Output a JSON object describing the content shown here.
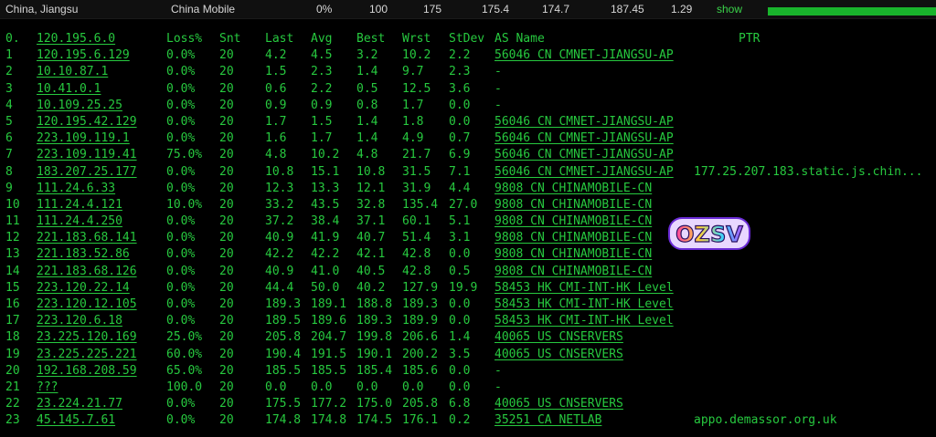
{
  "summary": {
    "location": "China, Jiangsu",
    "isp": "China Mobile",
    "loss": "0%",
    "sent": "100",
    "v1": "175",
    "v2": "175.4",
    "v3": "174.7",
    "v4": "187.45",
    "v5": "1.29",
    "show_label": "show"
  },
  "header": {
    "idx": "0.",
    "host": "120.195.6.0",
    "loss": "Loss%",
    "snt": "Snt",
    "last": "Last",
    "avg": "Avg",
    "best": "Best",
    "wrst": "Wrst",
    "stdev": "StDev",
    "as": "AS Name",
    "ptr": "PTR"
  },
  "hops": [
    {
      "idx": "1",
      "host": "120.195.6.129",
      "loss": "0.0%",
      "snt": "20",
      "last": "4.2",
      "avg": "4.5",
      "best": "3.2",
      "wrst": "10.2",
      "stdev": "2.2",
      "as": "56046 CN CMNET-JIANGSU-AP",
      "ptr": ""
    },
    {
      "idx": "2",
      "host": "10.10.87.1",
      "loss": "0.0%",
      "snt": "20",
      "last": "1.5",
      "avg": "2.3",
      "best": "1.4",
      "wrst": "9.7",
      "stdev": "2.3",
      "as": "-",
      "ptr": ""
    },
    {
      "idx": "3",
      "host": "10.41.0.1",
      "loss": "0.0%",
      "snt": "20",
      "last": "0.6",
      "avg": "2.2",
      "best": "0.5",
      "wrst": "12.5",
      "stdev": "3.6",
      "as": "-",
      "ptr": ""
    },
    {
      "idx": "4",
      "host": "10.109.25.25",
      "loss": "0.0%",
      "snt": "20",
      "last": "0.9",
      "avg": "0.9",
      "best": "0.8",
      "wrst": "1.7",
      "stdev": "0.0",
      "as": "-",
      "ptr": ""
    },
    {
      "idx": "5",
      "host": "120.195.42.129",
      "loss": "0.0%",
      "snt": "20",
      "last": "1.7",
      "avg": "1.5",
      "best": "1.4",
      "wrst": "1.8",
      "stdev": "0.0",
      "as": "56046 CN CMNET-JIANGSU-AP",
      "ptr": ""
    },
    {
      "idx": "6",
      "host": "223.109.119.1",
      "loss": "0.0%",
      "snt": "20",
      "last": "1.6",
      "avg": "1.7",
      "best": "1.4",
      "wrst": "4.9",
      "stdev": "0.7",
      "as": "56046 CN CMNET-JIANGSU-AP",
      "ptr": ""
    },
    {
      "idx": "7",
      "host": "223.109.119.41",
      "loss": "75.0%",
      "snt": "20",
      "last": "4.8",
      "avg": "10.2",
      "best": "4.8",
      "wrst": "21.7",
      "stdev": "6.9",
      "as": "56046 CN CMNET-JIANGSU-AP",
      "ptr": ""
    },
    {
      "idx": "8",
      "host": "183.207.25.177",
      "loss": "0.0%",
      "snt": "20",
      "last": "10.8",
      "avg": "15.1",
      "best": "10.8",
      "wrst": "31.5",
      "stdev": "7.1",
      "as": "56046 CN CMNET-JIANGSU-AP",
      "ptr": "177.25.207.183.static.js.chin..."
    },
    {
      "idx": "9",
      "host": "111.24.6.33",
      "loss": "0.0%",
      "snt": "20",
      "last": "12.3",
      "avg": "13.3",
      "best": "12.1",
      "wrst": "31.9",
      "stdev": "4.4",
      "as": "9808  CN CHINAMOBILE-CN",
      "ptr": ""
    },
    {
      "idx": "10",
      "host": "111.24.4.121",
      "loss": "10.0%",
      "snt": "20",
      "last": "33.2",
      "avg": "43.5",
      "best": "32.8",
      "wrst": "135.4",
      "stdev": "27.0",
      "as": "9808  CN CHINAMOBILE-CN",
      "ptr": ""
    },
    {
      "idx": "11",
      "host": "111.24.4.250",
      "loss": "0.0%",
      "snt": "20",
      "last": "37.2",
      "avg": "38.4",
      "best": "37.1",
      "wrst": "60.1",
      "stdev": "5.1",
      "as": "9808  CN CHINAMOBILE-CN",
      "ptr": ""
    },
    {
      "idx": "12",
      "host": "221.183.68.141",
      "loss": "0.0%",
      "snt": "20",
      "last": "40.9",
      "avg": "41.9",
      "best": "40.7",
      "wrst": "51.4",
      "stdev": "3.1",
      "as": "9808  CN CHINAMOBILE-CN",
      "ptr": ""
    },
    {
      "idx": "13",
      "host": "221.183.52.86",
      "loss": "0.0%",
      "snt": "20",
      "last": "42.2",
      "avg": "42.2",
      "best": "42.1",
      "wrst": "42.8",
      "stdev": "0.0",
      "as": "9808  CN CHINAMOBILE-CN",
      "ptr": ""
    },
    {
      "idx": "14",
      "host": "221.183.68.126",
      "loss": "0.0%",
      "snt": "20",
      "last": "40.9",
      "avg": "41.0",
      "best": "40.5",
      "wrst": "42.8",
      "stdev": "0.5",
      "as": "9808  CN CHINAMOBILE-CN",
      "ptr": ""
    },
    {
      "idx": "15",
      "host": "223.120.22.14",
      "loss": "0.0%",
      "snt": "20",
      "last": "44.4",
      "avg": "50.0",
      "best": "40.2",
      "wrst": "127.9",
      "stdev": "19.9",
      "as": "58453 HK CMI-INT-HK Level",
      "ptr": ""
    },
    {
      "idx": "16",
      "host": "223.120.12.105",
      "loss": "0.0%",
      "snt": "20",
      "last": "189.3",
      "avg": "189.1",
      "best": "188.8",
      "wrst": "189.3",
      "stdev": "0.0",
      "as": "58453 HK CMI-INT-HK Level",
      "ptr": ""
    },
    {
      "idx": "17",
      "host": "223.120.6.18",
      "loss": "0.0%",
      "snt": "20",
      "last": "189.5",
      "avg": "189.6",
      "best": "189.3",
      "wrst": "189.9",
      "stdev": "0.0",
      "as": "58453 HK CMI-INT-HK Level",
      "ptr": ""
    },
    {
      "idx": "18",
      "host": "23.225.120.169",
      "loss": "25.0%",
      "snt": "20",
      "last": "205.8",
      "avg": "204.7",
      "best": "199.8",
      "wrst": "206.6",
      "stdev": "1.4",
      "as": "40065 US CNSERVERS",
      "ptr": ""
    },
    {
      "idx": "19",
      "host": "23.225.225.221",
      "loss": "60.0%",
      "snt": "20",
      "last": "190.4",
      "avg": "191.5",
      "best": "190.1",
      "wrst": "200.2",
      "stdev": "3.5",
      "as": "40065 US CNSERVERS",
      "ptr": ""
    },
    {
      "idx": "20",
      "host": "192.168.208.59",
      "loss": "65.0%",
      "snt": "20",
      "last": "185.5",
      "avg": "185.5",
      "best": "185.4",
      "wrst": "185.6",
      "stdev": "0.0",
      "as": "-",
      "ptr": ""
    },
    {
      "idx": "21",
      "host": "???",
      "loss": "100.0",
      "snt": "20",
      "last": "0.0",
      "avg": "0.0",
      "best": "0.0",
      "wrst": "0.0",
      "stdev": "0.0",
      "as": "-",
      "ptr": ""
    },
    {
      "idx": "22",
      "host": "23.224.21.77",
      "loss": "0.0%",
      "snt": "20",
      "last": "175.5",
      "avg": "177.2",
      "best": "175.0",
      "wrst": "205.8",
      "stdev": "6.8",
      "as": "40065 US CNSERVERS",
      "ptr": ""
    },
    {
      "idx": "23",
      "host": "45.145.7.61",
      "loss": "0.0%",
      "snt": "20",
      "last": "174.8",
      "avg": "174.8",
      "best": "174.5",
      "wrst": "176.1",
      "stdev": "0.2",
      "as": "35251 CA NETLAB",
      "ptr": "appo.demassor.org.uk"
    }
  ],
  "watermark": {
    "text": "OZSV"
  },
  "colors": {
    "text": "#27c93f",
    "background": "#000000",
    "progress": "#19b42c"
  }
}
